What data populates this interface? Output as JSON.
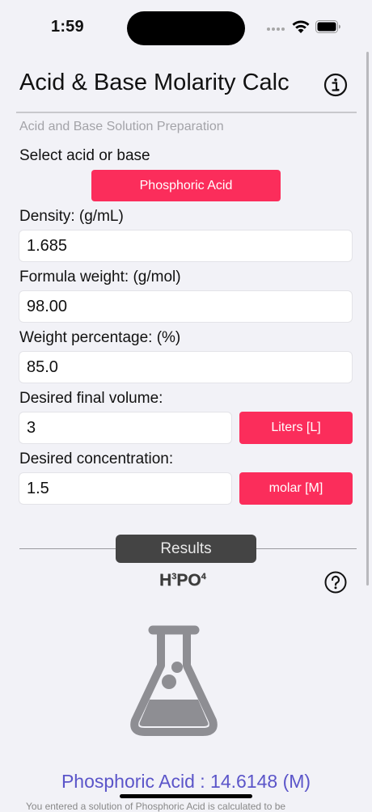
{
  "status": {
    "time": "1:59"
  },
  "header": {
    "title": "Acid & Base Molarity Calc",
    "subtitle": "Acid and Base Solution Preparation"
  },
  "select": {
    "label": "Select acid or base",
    "value": "Phosphoric Acid"
  },
  "density": {
    "label": "Density:  (g/mL)",
    "value": "1.685"
  },
  "formula_weight": {
    "label": "Formula weight:  (g/mol)",
    "value": "98.00"
  },
  "weight_percentage": {
    "label": "Weight percentage:  (%)",
    "value": "85.0"
  },
  "final_volume": {
    "label": "Desired final volume:",
    "value": "3",
    "unit": "Liters [L]"
  },
  "concentration": {
    "label": "Desired concentration:",
    "value": "1.5",
    "unit": "molar [M]"
  },
  "results": {
    "tab_label": "Results",
    "formula": {
      "h": "H",
      "sub1": "3",
      "po": "PO",
      "sub2": "4"
    },
    "result_line": "Phosphoric Acid : 14.6148 (M)",
    "footnote": "You entered a solution of Phosphoric Acid is calculated to be"
  },
  "colors": {
    "accent": "#fb2d5b",
    "result": "#5b55c9",
    "tab": "#444444"
  }
}
